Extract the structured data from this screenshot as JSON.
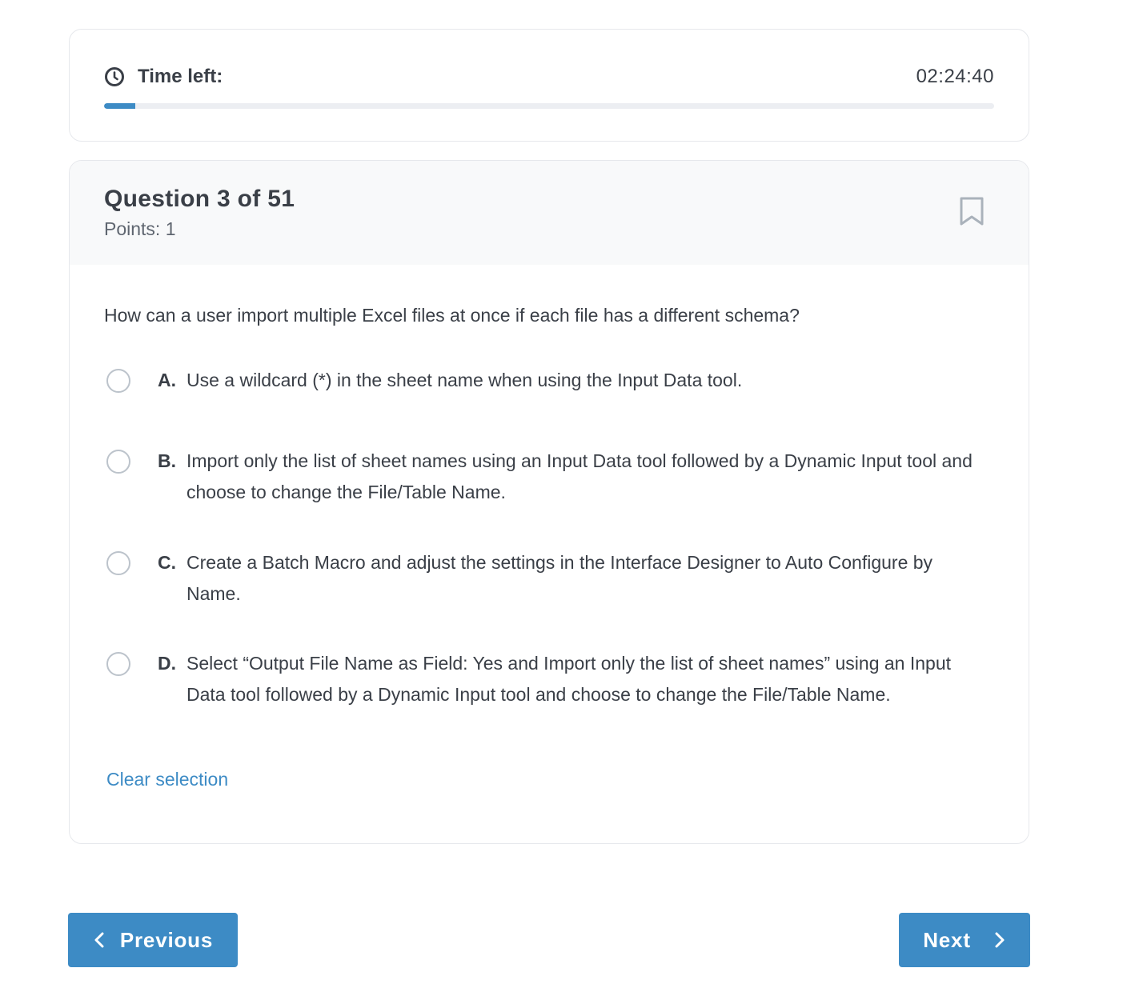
{
  "timer": {
    "label": "Time left:",
    "value": "02:24:40",
    "progress_fraction": 0.035,
    "icon": "clock-icon"
  },
  "question": {
    "title": "Question 3 of 51",
    "points": "Points: 1",
    "bookmark_icon": "bookmark-icon",
    "text": "How can a user import multiple Excel files at once if each file has a different schema?",
    "options": [
      {
        "letter": "A.",
        "text": "Use a wildcard (*) in the sheet name when using the Input Data tool."
      },
      {
        "letter": "B.",
        "text": "Import only the list of sheet names using an Input Data tool followed by a Dynamic Input tool and choose to change the File/Table Name."
      },
      {
        "letter": "C.",
        "text": "Create a Batch Macro and adjust the settings in the Interface Designer to Auto Configure by Name."
      },
      {
        "letter": "D.",
        "text": "Select “Output File Name as Field: Yes and Import only the list of sheet names” using an Input Data tool followed by a Dynamic Input tool and choose to change the File/Table Name."
      }
    ],
    "clear_label": "Clear selection"
  },
  "nav": {
    "previous_label": "Previous",
    "next_label": "Next"
  },
  "colors": {
    "accent": "#3d8bc5",
    "text": "#3a3f47",
    "muted": "#5f6670",
    "header_bg": "#f8f9fa"
  }
}
